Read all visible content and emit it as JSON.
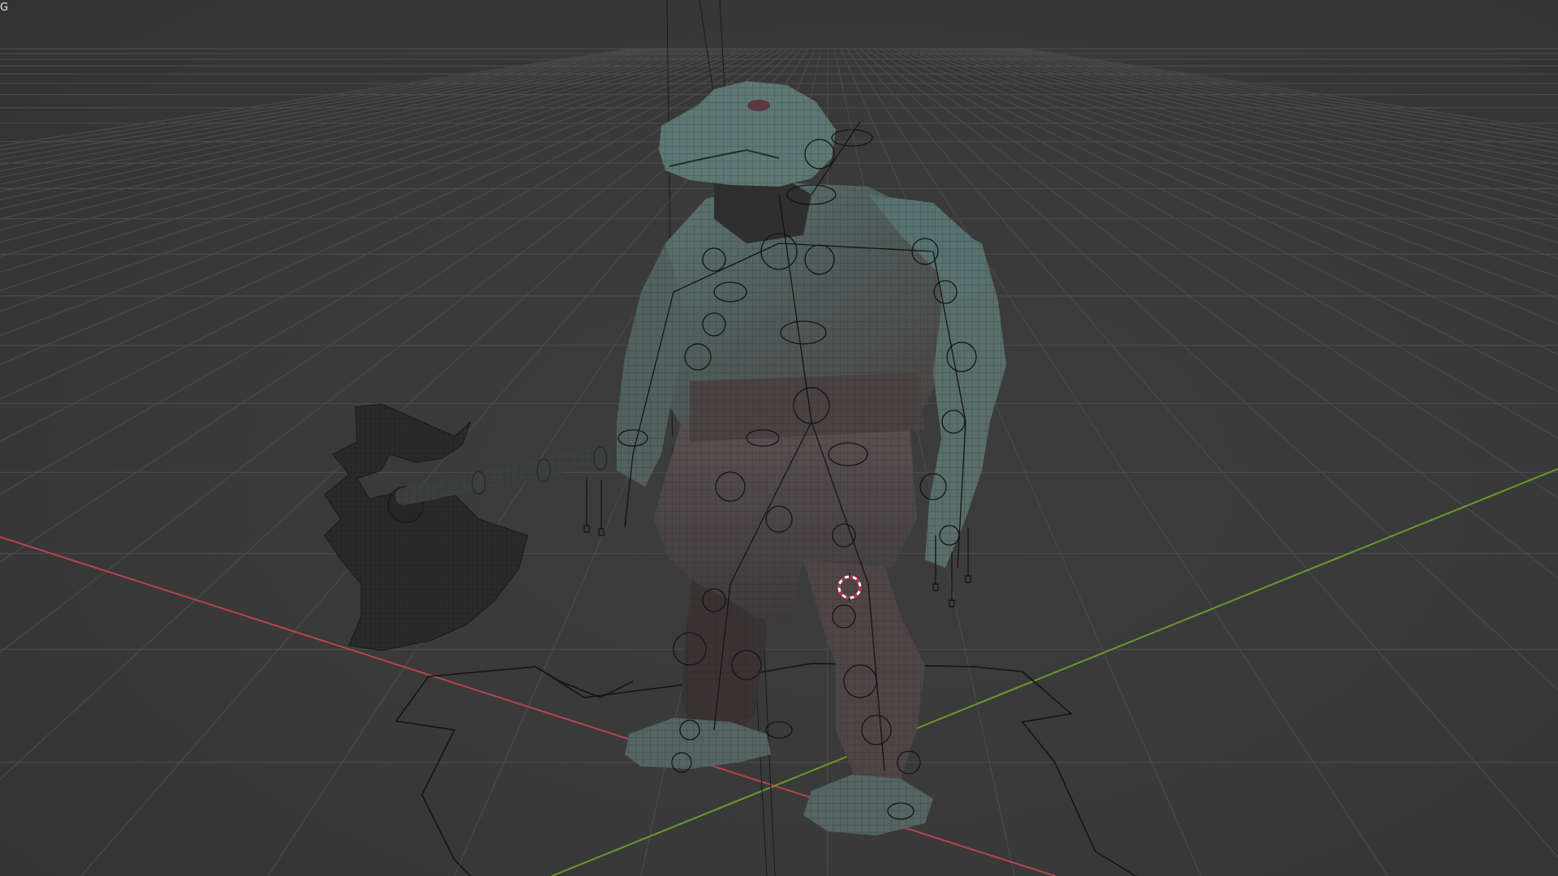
{
  "viewport": {
    "corner_text": "G",
    "background_color": "#393939",
    "grid_color": "#4a4a4a",
    "x_axis_color": "#b8444f",
    "y_axis_color": "#6c9a2c",
    "mesh_color": "#58706c",
    "mesh_dark_color": "#2e2e2e",
    "rig_color": "#141414",
    "cursor_color": "#c8283a"
  },
  "scene": {
    "object": "character-mesh",
    "weapon": "axe",
    "overlays": [
      "wireframe",
      "armature-controls"
    ]
  }
}
